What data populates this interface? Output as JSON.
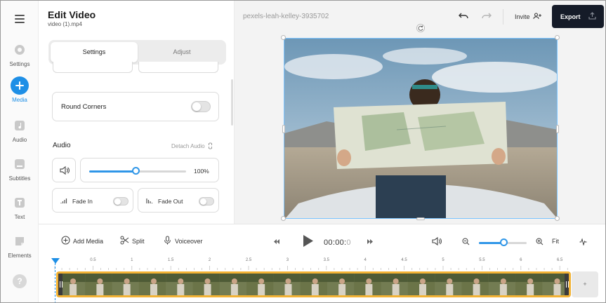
{
  "rail": {
    "items": [
      {
        "label": "Settings",
        "icon": "gear-icon"
      },
      {
        "label": "Media",
        "icon": "plus-icon",
        "active": true
      },
      {
        "label": "Audio",
        "icon": "music-note-icon"
      },
      {
        "label": "Subtitles",
        "icon": "subtitles-icon"
      },
      {
        "label": "Text",
        "icon": "text-icon"
      },
      {
        "label": "Elements",
        "icon": "elements-icon"
      }
    ],
    "help": "?"
  },
  "panel": {
    "title": "Edit Video",
    "filename": "video (1).mp4",
    "tabs": [
      "Settings",
      "Adjust"
    ],
    "round_corners": "Round Corners",
    "audio_title": "Audio",
    "detach_audio": "Detach Audio",
    "volume_percent": 100,
    "volume_label": "100%",
    "fade_in": "Fade In",
    "fade_out": "Fade Out"
  },
  "stage": {
    "project_name": "pexels-leah-kelley-3935702",
    "invite": "Invite",
    "export": "Export"
  },
  "toolbar": {
    "add_media": "Add Media",
    "split": "Split",
    "voiceover": "Voiceover",
    "time_main": "00:00:",
    "time_dim": "0",
    "fit": "Fit",
    "zoom_level": 0.52
  },
  "timeline": {
    "ticks": [
      "0.5",
      "1",
      "1.5",
      "2",
      "2.5",
      "3",
      "3.5",
      "4",
      "4.5",
      "5",
      "5.5",
      "6",
      "6.5"
    ],
    "add_clip": "+"
  },
  "colors": {
    "accent": "#1e8fe6",
    "export_bg": "#151b28",
    "clip_border": "#f2b234"
  }
}
